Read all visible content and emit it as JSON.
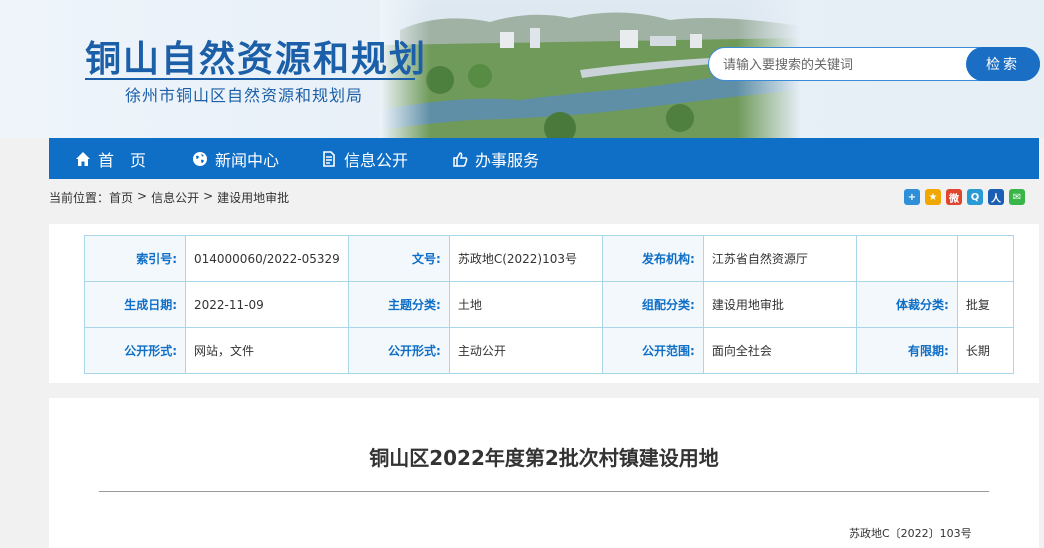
{
  "header": {
    "title": "铜山自然资源和规划",
    "subtitle": "徐州市铜山区自然资源和规划局"
  },
  "search": {
    "placeholder": "请输入要搜索的关键词",
    "button_label": "检索"
  },
  "nav": {
    "items": [
      {
        "label": "首　页",
        "icon": "home-icon"
      },
      {
        "label": "新闻中心",
        "icon": "globe-icon"
      },
      {
        "label": "信息公开",
        "icon": "document-icon"
      },
      {
        "label": "办事服务",
        "icon": "thumbs-up-icon"
      }
    ]
  },
  "breadcrumb": {
    "prefix": "当前位置：",
    "items": [
      "首页",
      "信息公开",
      "建设用地审批"
    ],
    "separator": ">"
  },
  "share": {
    "icons": [
      {
        "name": "share-plus-icon",
        "glyph": "+",
        "color": "#2e8fd8"
      },
      {
        "name": "qzone-icon",
        "glyph": "★",
        "color": "#f0a800"
      },
      {
        "name": "weibo-icon",
        "glyph": "微",
        "color": "#e0452e"
      },
      {
        "name": "tencent-weibo-icon",
        "glyph": "Q",
        "color": "#2a9ad6"
      },
      {
        "name": "renren-icon",
        "glyph": "人",
        "color": "#1a5fb4"
      },
      {
        "name": "wechat-icon",
        "glyph": "✉",
        "color": "#39b54a"
      }
    ]
  },
  "meta": {
    "rows": [
      [
        {
          "label": "索引号:",
          "value": "014000060/2022-05329"
        },
        {
          "label": "文号:",
          "value": "苏政地C(2022)103号"
        },
        {
          "label": "发布机构:",
          "value": "江苏省自然资源厅"
        },
        {
          "label": "",
          "value": ""
        }
      ],
      [
        {
          "label": "生成日期:",
          "value": "2022-11-09"
        },
        {
          "label": "主题分类:",
          "value": "土地"
        },
        {
          "label": "组配分类:",
          "value": "建设用地审批"
        },
        {
          "label": "体裁分类:",
          "value": "批复"
        }
      ],
      [
        {
          "label": "公开形式:",
          "value": "网站，文件"
        },
        {
          "label": "公开形式:",
          "value": "主动公开"
        },
        {
          "label": "公开范围:",
          "value": "面向全社会"
        },
        {
          "label": "有限期:",
          "value": "长期"
        }
      ]
    ]
  },
  "article": {
    "title": "铜山区2022年度第2批次村镇建设用地",
    "doc_number": "苏政地C〔2022〕103号"
  },
  "colors": {
    "brand_blue": "#0f6ec6",
    "title_blue": "#1b5fa8",
    "table_border": "#a9d6e9"
  }
}
